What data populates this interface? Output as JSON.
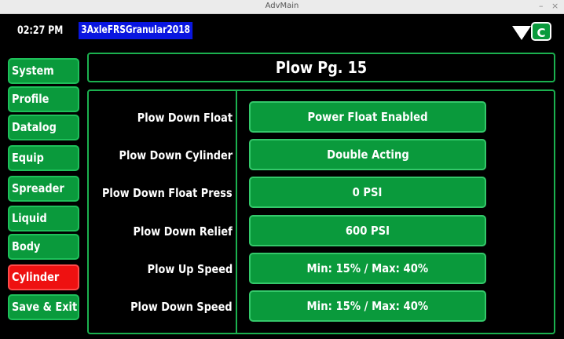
{
  "window": {
    "title": "AdvMain",
    "minimize": "–",
    "close": "×"
  },
  "status": {
    "time": "02:27 PM",
    "profile": "3AxleFRSGranular2018",
    "connection_label": "C",
    "connection_color": "#0a9a3c"
  },
  "sidebar": {
    "items": [
      {
        "label": "System"
      },
      {
        "label": "Profile"
      },
      {
        "label": "Datalog"
      },
      {
        "label": "Equip"
      },
      {
        "label": "Spreader"
      },
      {
        "label": "Liquid"
      },
      {
        "label": "Body"
      },
      {
        "label": "Cylinder",
        "active": true
      },
      {
        "label": "Save & Exit"
      }
    ]
  },
  "page": {
    "title": "Plow Pg. 15"
  },
  "settings": [
    {
      "label": "Plow Down Float",
      "value": "Power Float Enabled"
    },
    {
      "label": "Plow Down Cylinder",
      "value": "Double Acting"
    },
    {
      "label": "Plow Down Float Press",
      "value": "0 PSI"
    },
    {
      "label": "Plow Down Relief",
      "value": "600 PSI"
    },
    {
      "label": "Plow Up Speed",
      "value": "Min: 15% / Max: 40%"
    },
    {
      "label": "Plow Down Speed",
      "value": "Min: 15% / Max: 40%"
    }
  ],
  "colors": {
    "accent_green": "#0a9a3c",
    "active_red": "#ee1111",
    "profile_blue": "#0a16e0",
    "background": "#000000"
  }
}
